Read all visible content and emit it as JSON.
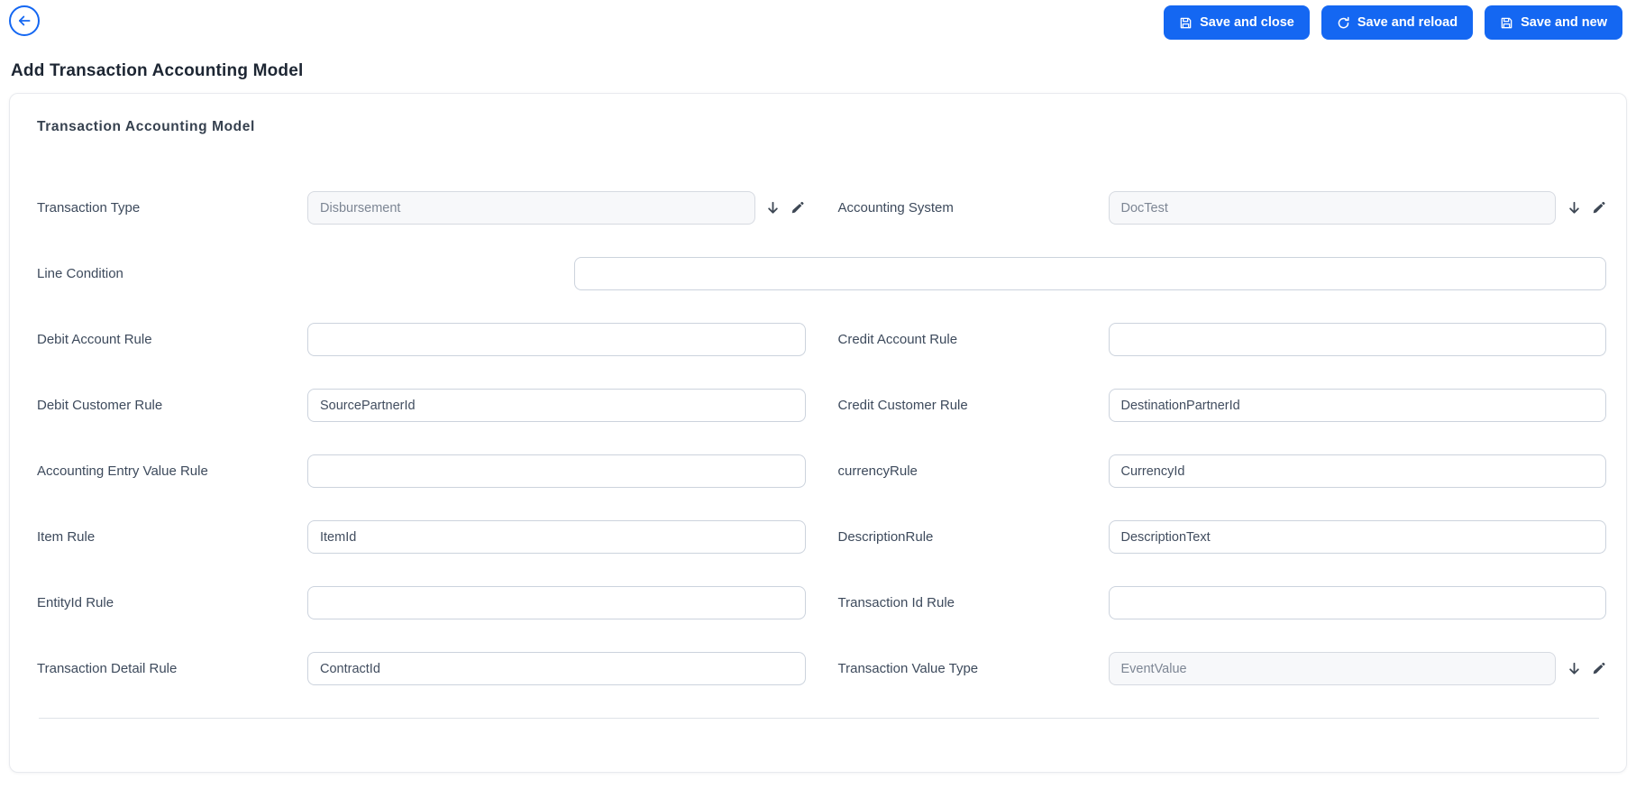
{
  "colors": {
    "primary": "#1467f2",
    "card_border": "#e8eaee",
    "input_border": "#ccd3dd",
    "readonly_bg": "#f7f8fa",
    "label_text": "#3d4a5c",
    "readonly_text": "#7d8694"
  },
  "header": {
    "back_icon": "arrow-left-icon",
    "buttons": [
      {
        "label": "Save and close",
        "icon": "save-icon"
      },
      {
        "label": "Save and reload",
        "icon": "reload-icon"
      },
      {
        "label": "Save and new",
        "icon": "save-icon"
      }
    ]
  },
  "page_title": "Add Transaction Accounting Model",
  "form": {
    "section_title": "Transaction Accounting Model",
    "fields": {
      "transaction_type": {
        "label": "Transaction Type",
        "value": "Disbursement",
        "type": "lookup",
        "icons": [
          "arrow-down-icon",
          "pencil-icon"
        ]
      },
      "accounting_system": {
        "label": "Accounting System",
        "value": "DocTest",
        "type": "lookup",
        "icons": [
          "arrow-down-icon",
          "pencil-icon"
        ]
      },
      "line_condition": {
        "label": "Line Condition",
        "value": "",
        "type": "text"
      },
      "debit_account_rule": {
        "label": "Debit Account Rule",
        "value": "",
        "type": "text"
      },
      "credit_account_rule": {
        "label": "Credit Account Rule",
        "value": "",
        "type": "text"
      },
      "debit_customer_rule": {
        "label": "Debit Customer Rule",
        "value": "SourcePartnerId",
        "type": "text"
      },
      "credit_customer_rule": {
        "label": "Credit Customer Rule",
        "value": "DestinationPartnerId",
        "type": "text"
      },
      "accounting_entry_value_rule": {
        "label": "Accounting Entry Value Rule",
        "value": "",
        "type": "text"
      },
      "currency_rule": {
        "label": "currencyRule",
        "value": "CurrencyId",
        "type": "text"
      },
      "item_rule": {
        "label": "Item Rule",
        "value": "ItemId",
        "type": "text"
      },
      "description_rule": {
        "label": "DescriptionRule",
        "value": "DescriptionText",
        "type": "text"
      },
      "entityid_rule": {
        "label": "EntityId Rule",
        "value": "",
        "type": "text"
      },
      "transaction_id_rule": {
        "label": "Transaction Id Rule",
        "value": "",
        "type": "text"
      },
      "transaction_detail_rule": {
        "label": "Transaction Detail Rule",
        "value": "ContractId",
        "type": "text"
      },
      "transaction_value_type": {
        "label": "Transaction Value Type",
        "value": "EventValue",
        "type": "lookup",
        "icons": [
          "arrow-down-icon",
          "pencil-icon"
        ]
      }
    }
  }
}
